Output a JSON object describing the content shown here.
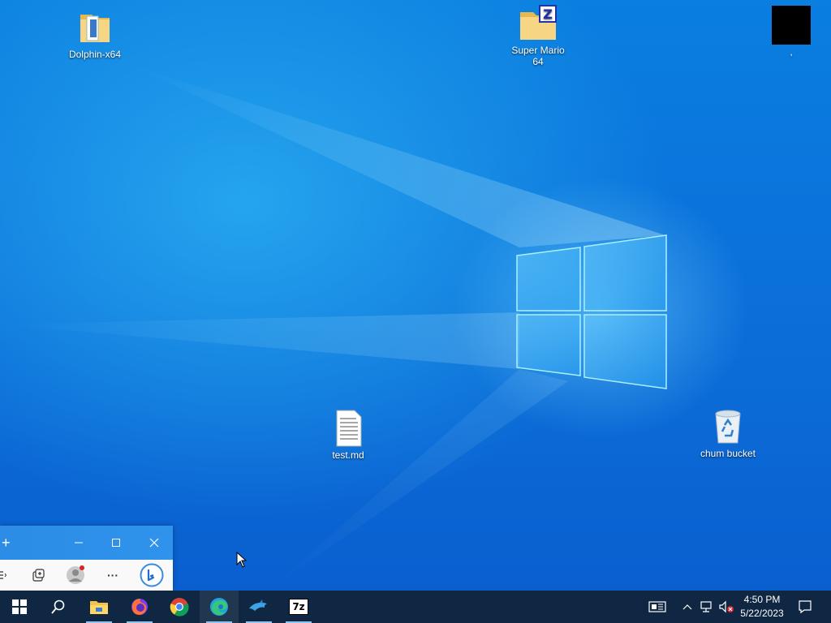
{
  "desktop": {
    "icons": [
      {
        "name": "dolphin-x64-folder",
        "label": "Dolphin-x64",
        "icon": "folder-icon"
      },
      {
        "name": "super-mario-64-archive",
        "label": "Super Mario 64",
        "icon": "zip-folder-icon"
      },
      {
        "name": "black-square-shortcut",
        "label": ",",
        "icon": "black-square-icon"
      },
      {
        "name": "test-md-file",
        "label": "test.md",
        "icon": "text-file-icon"
      },
      {
        "name": "recycle-bin",
        "label": "chum bucket",
        "icon": "recycle-bin-icon"
      }
    ]
  },
  "edge_window": {
    "titlebar": {
      "new_tab": "+",
      "minimize": "–",
      "maximize": "□",
      "close": "✕"
    },
    "toolbar": [
      "favorites-list-icon",
      "collections-icon",
      "profile-icon",
      "more-dots-icon",
      "bing-chat-icon"
    ],
    "more_dots": "···"
  },
  "taskbar": {
    "apps": [
      "start-icon",
      "search-icon",
      "file-explorer-icon",
      "firefox-icon",
      "chrome-icon",
      "edge-icon",
      "dolphin-icon",
      "7zip-icon"
    ],
    "seven_zip_label": "7z",
    "tray": {
      "chevron": "^",
      "time": "4:50 PM",
      "date": "5/22/2023"
    }
  },
  "colors": {
    "taskbar": "#0f2742",
    "desktop_blue": "#0b74dc",
    "edge_title": "#2c8ce6"
  }
}
